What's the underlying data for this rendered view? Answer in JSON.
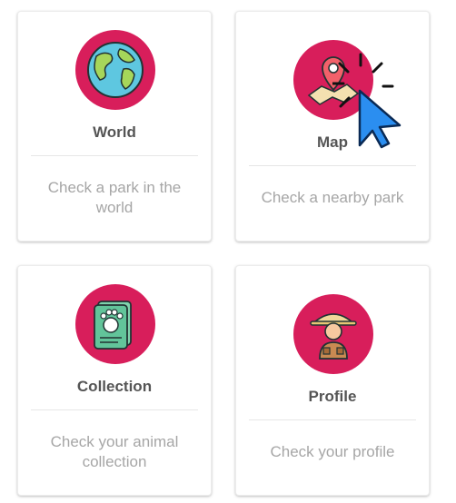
{
  "cards": [
    {
      "title": "World",
      "description": "Check a park in the world",
      "icon": "globe-icon"
    },
    {
      "title": "Map",
      "description": "Check a nearby park",
      "icon": "map-pin-icon"
    },
    {
      "title": "Collection",
      "description": "Check your animal collection",
      "icon": "paw-book-icon"
    },
    {
      "title": "Profile",
      "description": "Check your profile",
      "icon": "explorer-avatar-icon"
    }
  ],
  "colors": {
    "accent": "#d81e5b",
    "title": "#555555",
    "description": "#a6a6a6"
  },
  "overlay": {
    "icon": "mouse-pointer-click-icon"
  }
}
